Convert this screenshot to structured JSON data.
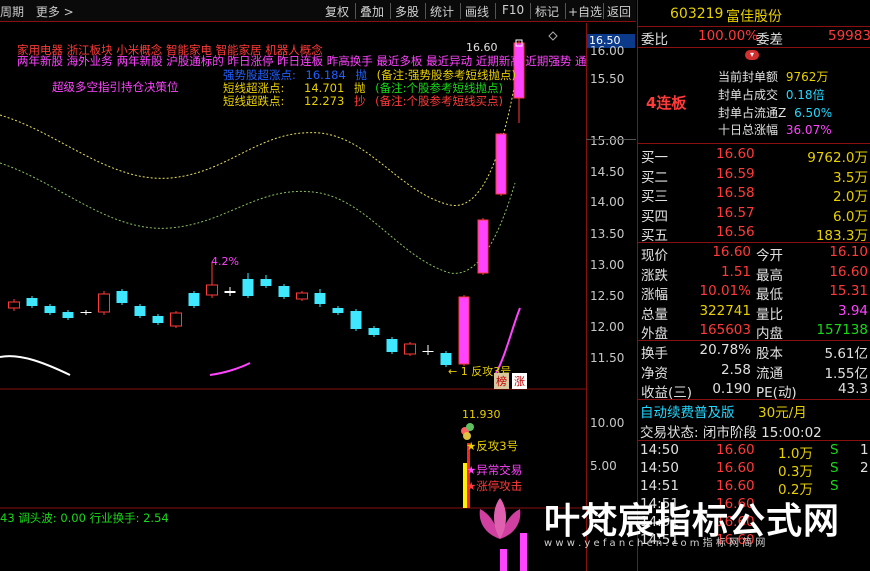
{
  "toolbar": {
    "left": [
      "周期",
      "更多 >"
    ],
    "buttons": [
      "复权",
      "叠加",
      "多股",
      "统计",
      "画线",
      "F10",
      "标记",
      "+自选",
      "返回"
    ]
  },
  "chart": {
    "price_tag": "16.50",
    "y_ticks_top": [
      "16.00",
      "15.50",
      "15.00",
      "14.50",
      "14.00",
      "13.50",
      "13.00",
      "12.50",
      "12.00",
      "11.50"
    ],
    "y_ticks_bottom": [
      "10.00",
      "5.00"
    ],
    "concept_line1": "家用电器  浙江板块  小米概念 智能家电 智能家居 机器人概念",
    "concept_line2": "两年新股 沪股通标的 昨日涨停 昨日连板 昨高换手 最近多板 最近异动 近期新高 近期强势 通达信热",
    "concept_line2_prefix": "两年新股  海外业务",
    "super_label": "超级多空指引持仓决策位",
    "strong_top_label": "强势股超涨点:",
    "strong_top_value": "16.184",
    "strong_top_action": "抛",
    "strong_top_note": "(备注:强势股参考短线抛点)",
    "short_top_label": "短线超涨点:",
    "short_top_value": "14.701",
    "short_top_action": "抛",
    "short_top_note": "(备注:个股参考短线抛点)",
    "short_bottom_label": "短线超跌点:",
    "short_bottom_value": "12.273",
    "short_bottom_action": "抄",
    "short_bottom_note": "(备注:个股参考短线买点)",
    "pct_label": "4.2%",
    "high_label": "16.60",
    "low_label": "11.930",
    "arrow_label": "← 1 反攻3号",
    "tag_a": "榜",
    "tag_b": "涨",
    "star1": "★反攻3号",
    "star2": "★异常交易",
    "star3": "★涨停攻击",
    "bottom_status": "43  调头波: 0.00  行业换手: 2.54"
  },
  "quote": {
    "code": "603219",
    "name": "富佳股份",
    "weibi_label": "委比",
    "weibi_value": "100.00%",
    "weicha_label": "委差",
    "weicha_value": "59983",
    "streak": "4连板",
    "info": [
      {
        "label": "当前封单额",
        "value": "9762万"
      },
      {
        "label": "封单占成交",
        "value": "0.18倍"
      },
      {
        "label": "封单占流通Z",
        "value": "6.50%"
      },
      {
        "label": "十日总涨幅",
        "value": "36.07%"
      }
    ],
    "bids": [
      {
        "label": "买一",
        "price": "16.60",
        "vol": "9762.0万"
      },
      {
        "label": "买二",
        "price": "16.59",
        "vol": "3.5万"
      },
      {
        "label": "买三",
        "price": "16.58",
        "vol": "2.0万"
      },
      {
        "label": "买四",
        "price": "16.57",
        "vol": "6.0万"
      },
      {
        "label": "买五",
        "price": "16.56",
        "vol": "183.3万"
      }
    ],
    "stats": [
      {
        "l1": "现价",
        "v1": "16.60",
        "l2": "今开",
        "v2": "16.10"
      },
      {
        "l1": "涨跌",
        "v1": "1.51",
        "l2": "最高",
        "v2": "16.60"
      },
      {
        "l1": "涨幅",
        "v1": "10.01%",
        "l2": "最低",
        "v2": "15.31"
      },
      {
        "l1": "总量",
        "v1": "322741",
        "l2": "量比",
        "v2": "3.94"
      },
      {
        "l1": "外盘",
        "v1": "165603",
        "l2": "内盘",
        "v2": "157138"
      }
    ],
    "fund": [
      {
        "l1": "换手",
        "v1": "20.78%",
        "l2": "股本",
        "v2": "5.61亿"
      },
      {
        "l1": "净资",
        "v1": "2.58",
        "l2": "流通",
        "v2": "1.55亿"
      },
      {
        "l1": "收益(三)",
        "v1": "0.190",
        "l2": "PE(动)",
        "v2": "43.3"
      }
    ],
    "promo_left": "自动续费普及版",
    "promo_right": "30元/月",
    "trade_state": "交易状态: 闭市阶段 15:00:02",
    "ticks": [
      {
        "time": "14:50",
        "price": "16.60",
        "vol": "1.0万",
        "side": "S",
        "n": "1"
      },
      {
        "time": "14:50",
        "price": "16.60",
        "vol": "0.3万",
        "side": "S",
        "n": "2"
      },
      {
        "time": "14:51",
        "price": "16.60",
        "vol": "0.2万",
        "side": "S",
        "n": ""
      },
      {
        "time": "14:51",
        "price": "16.60",
        "vol": "",
        "side": "",
        "n": ""
      },
      {
        "time": "14:51",
        "price": "16.60",
        "vol": "",
        "side": "",
        "n": ""
      },
      {
        "time": "14:51",
        "price": "16.60",
        "vol": "",
        "side": "",
        "n": ""
      }
    ]
  },
  "watermark": {
    "text": "叶梵宸指标公式网",
    "url": "w w w . y e f a n c h e n . c o m     指  标  网  简  网"
  }
}
